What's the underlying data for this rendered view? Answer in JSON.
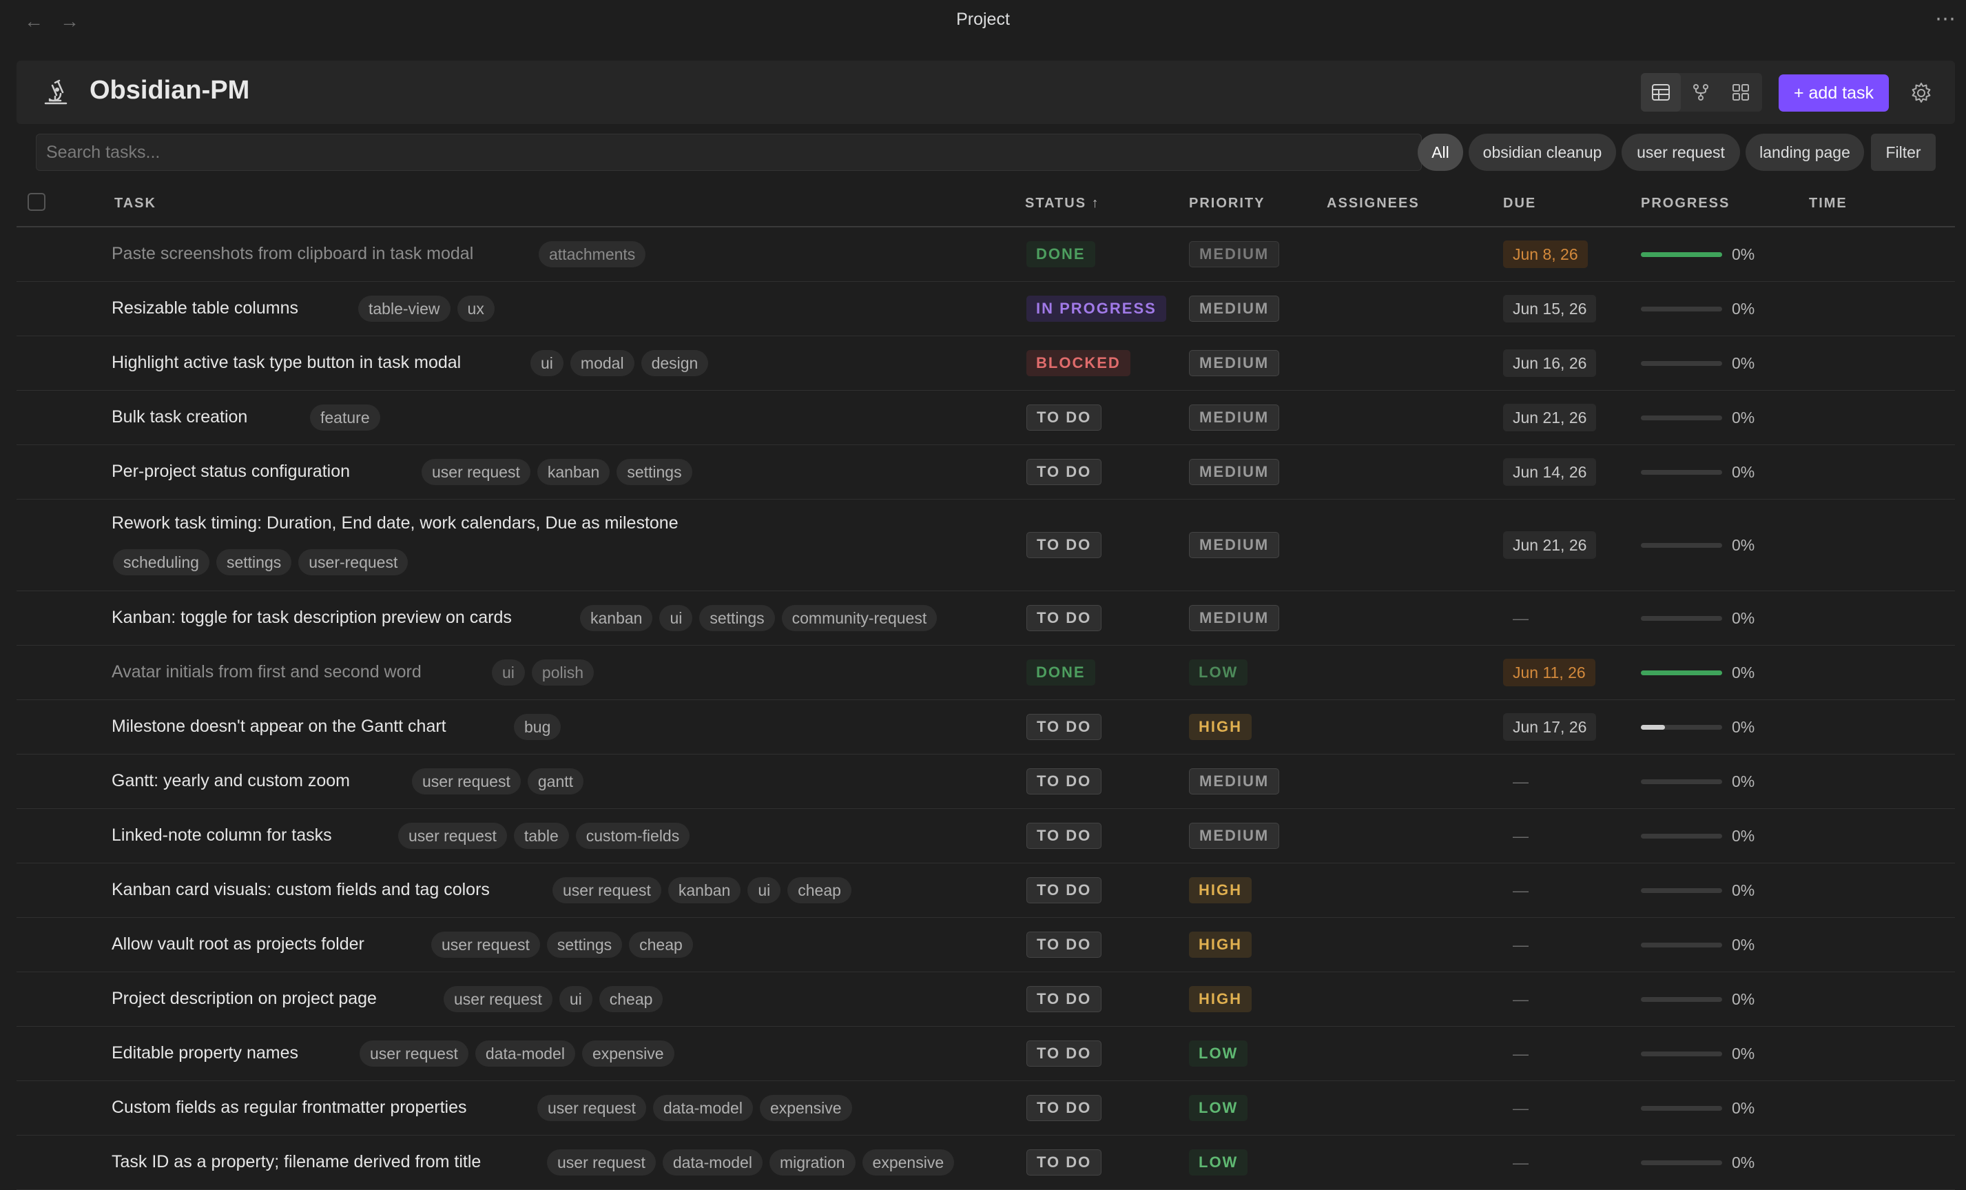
{
  "window": {
    "title": "Project",
    "more": "⋯",
    "back": "←",
    "forward": "→"
  },
  "header": {
    "project_title": "Obsidian-PM",
    "add_task_label": "+ add task"
  },
  "search": {
    "placeholder": "Search tasks..."
  },
  "filters": [
    {
      "label": "All",
      "active": true
    },
    {
      "label": "obsidian cleanup",
      "active": false
    },
    {
      "label": "user request",
      "active": false
    },
    {
      "label": "landing page",
      "active": false
    }
  ],
  "filter_button": "Filter",
  "columns": {
    "task": "TASK",
    "status": "STATUS ↑",
    "priority": "PRIORITY",
    "assignees": "ASSIGNEES",
    "due": "DUE",
    "progress": "PROGRESS",
    "time": "TIME"
  },
  "colors": {
    "accent": "#7c4dff",
    "done_green": "#4d9e5f",
    "progress_bar": "#3fa45b",
    "in_progress": "#a17ae8",
    "blocked": "#e06c6c",
    "high": "#e0b050",
    "due_warn": "#d48a3c"
  },
  "tasks": [
    {
      "name": "Paste screenshots from clipboard in task modal",
      "tags": [
        "attachments"
      ],
      "status": "DONE",
      "priority": "MEDIUM",
      "due": "Jun 8, 26",
      "due_style": "warn",
      "progress_fill": 1.0,
      "progress_text": "0%",
      "done": true
    },
    {
      "name": "Resizable table columns",
      "tags": [
        "table-view",
        "ux"
      ],
      "status": "IN PROGRESS",
      "priority": "MEDIUM",
      "due": "Jun 15, 26",
      "due_style": "normal",
      "progress_fill": 0,
      "progress_text": "0%",
      "done": false
    },
    {
      "name": "Highlight active task type button in task modal",
      "tags": [
        "ui",
        "modal",
        "design"
      ],
      "status": "BLOCKED",
      "priority": "MEDIUM",
      "due": "Jun 16, 26",
      "due_style": "normal",
      "progress_fill": 0,
      "progress_text": "0%",
      "done": false
    },
    {
      "name": "Bulk task creation",
      "tags": [
        "feature"
      ],
      "status": "TO DO",
      "priority": "MEDIUM",
      "due": "Jun 21, 26",
      "due_style": "normal",
      "progress_fill": 0,
      "progress_text": "0%",
      "done": false
    },
    {
      "name": "Per-project status configuration",
      "tags": [
        "user request",
        "kanban",
        "settings"
      ],
      "status": "TO DO",
      "priority": "MEDIUM",
      "due": "Jun 14, 26",
      "due_style": "normal",
      "progress_fill": 0,
      "progress_text": "0%",
      "done": false
    },
    {
      "name": "Rework task timing: Duration, End date, work calendars, Due as milestone",
      "tags": [
        "scheduling",
        "settings",
        "user-request"
      ],
      "status": "TO DO",
      "priority": "MEDIUM",
      "due": "Jun 21, 26",
      "due_style": "normal",
      "progress_fill": 0,
      "progress_text": "0%",
      "done": false,
      "wrap": true
    },
    {
      "name": "Kanban: toggle for task description preview on cards",
      "tags": [
        "kanban",
        "ui",
        "settings",
        "community-request"
      ],
      "status": "TO DO",
      "priority": "MEDIUM",
      "due": "—",
      "due_style": "none",
      "progress_fill": 0,
      "progress_text": "0%",
      "done": false
    },
    {
      "name": "Avatar initials from first and second word",
      "tags": [
        "ui",
        "polish"
      ],
      "status": "DONE",
      "priority": "LOW",
      "due": "Jun 11, 26",
      "due_style": "warn",
      "progress_fill": 1.0,
      "progress_text": "0%",
      "done": true
    },
    {
      "name": "Milestone doesn't appear on the Gantt chart",
      "tags": [
        "bug"
      ],
      "status": "TO DO",
      "priority": "HIGH",
      "due": "Jun 17, 26",
      "due_style": "normal",
      "progress_fill": 0.3,
      "progress_text": "0%",
      "done": false
    },
    {
      "name": "Gantt: yearly and custom zoom",
      "tags": [
        "user request",
        "gantt"
      ],
      "status": "TO DO",
      "priority": "MEDIUM",
      "due": "—",
      "due_style": "none",
      "progress_fill": 0,
      "progress_text": "0%",
      "done": false
    },
    {
      "name": "Linked-note column for tasks",
      "tags": [
        "user request",
        "table",
        "custom-fields"
      ],
      "status": "TO DO",
      "priority": "MEDIUM",
      "due": "—",
      "due_style": "none",
      "progress_fill": 0,
      "progress_text": "0%",
      "done": false
    },
    {
      "name": "Kanban card visuals: custom fields and tag colors",
      "tags": [
        "user request",
        "kanban",
        "ui",
        "cheap"
      ],
      "status": "TO DO",
      "priority": "HIGH",
      "due": "—",
      "due_style": "none",
      "progress_fill": 0,
      "progress_text": "0%",
      "done": false
    },
    {
      "name": "Allow vault root as projects folder",
      "tags": [
        "user request",
        "settings",
        "cheap"
      ],
      "status": "TO DO",
      "priority": "HIGH",
      "due": "—",
      "due_style": "none",
      "progress_fill": 0,
      "progress_text": "0%",
      "done": false
    },
    {
      "name": "Project description on project page",
      "tags": [
        "user request",
        "ui",
        "cheap"
      ],
      "status": "TO DO",
      "priority": "HIGH",
      "due": "—",
      "due_style": "none",
      "progress_fill": 0,
      "progress_text": "0%",
      "done": false
    },
    {
      "name": "Editable property names",
      "tags": [
        "user request",
        "data-model",
        "expensive"
      ],
      "status": "TO DO",
      "priority": "LOW",
      "due": "—",
      "due_style": "none",
      "progress_fill": 0,
      "progress_text": "0%",
      "done": false
    },
    {
      "name": "Custom fields as regular frontmatter properties",
      "tags": [
        "user request",
        "data-model",
        "expensive"
      ],
      "status": "TO DO",
      "priority": "LOW",
      "due": "—",
      "due_style": "none",
      "progress_fill": 0,
      "progress_text": "0%",
      "done": false
    },
    {
      "name": "Task ID as a property; filename derived from title",
      "tags": [
        "user request",
        "data-model",
        "migration",
        "expensive"
      ],
      "status": "TO DO",
      "priority": "LOW",
      "due": "—",
      "due_style": "none",
      "progress_fill": 0,
      "progress_text": "0%",
      "done": false
    }
  ]
}
